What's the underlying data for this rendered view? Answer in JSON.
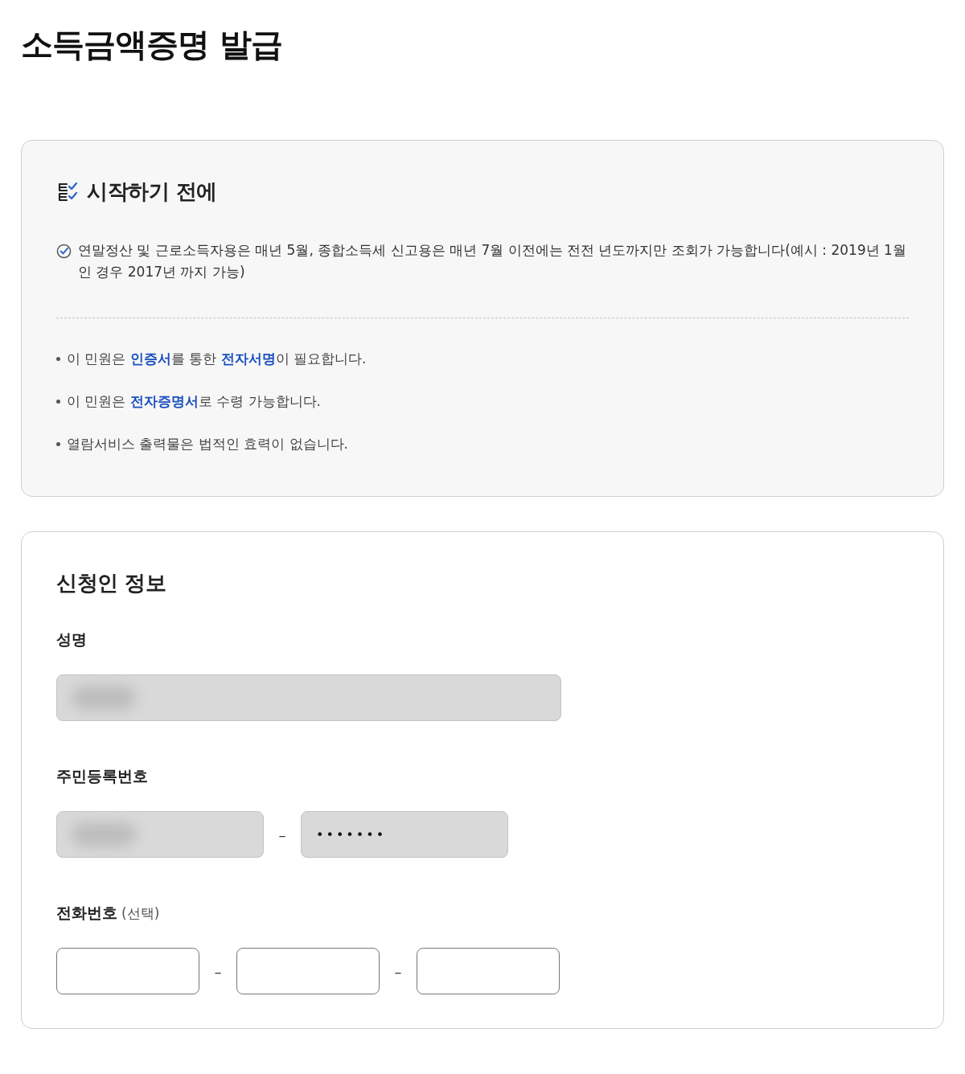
{
  "page_title": "소득금액증명 발급",
  "notice": {
    "title": "시작하기 전에",
    "check_item": "연말정산 및 근로소득자용은 매년 5월, 종합소득세 신고용은 매년 7월 이전에는 전전 년도까지만 조회가 가능합니다(예시 : 2019년 1월 인 경우 2017년 까지 가능)",
    "bullets": [
      "이 민원은 **인증서**를 통한 **전자서명**이 필요합니다.",
      "이 민원은 **전자증명서**로 수령 가능합니다.",
      "열람서비스 출력물은 법적인 효력이 없습니다."
    ]
  },
  "applicant": {
    "title": "신청인 정보",
    "fields": [
      {
        "kind": "single",
        "label": "성명",
        "inputs": [
          {
            "disabled": true,
            "redacted": true
          }
        ]
      },
      {
        "kind": "pair",
        "label": "주민등록번호",
        "inputs": [
          {
            "disabled": true,
            "redacted": true
          },
          {
            "disabled": true,
            "redacted": false,
            "value": "•••••••"
          }
        ],
        "separators": [
          "–"
        ]
      },
      {
        "kind": "triple",
        "label": "전화번호",
        "note": "(선택)",
        "inputs": [
          {
            "disabled": false,
            "redacted": false
          },
          {
            "disabled": false,
            "redacted": false
          },
          {
            "disabled": false,
            "redacted": false
          }
        ],
        "separators": [
          "–",
          "–"
        ]
      }
    ]
  }
}
